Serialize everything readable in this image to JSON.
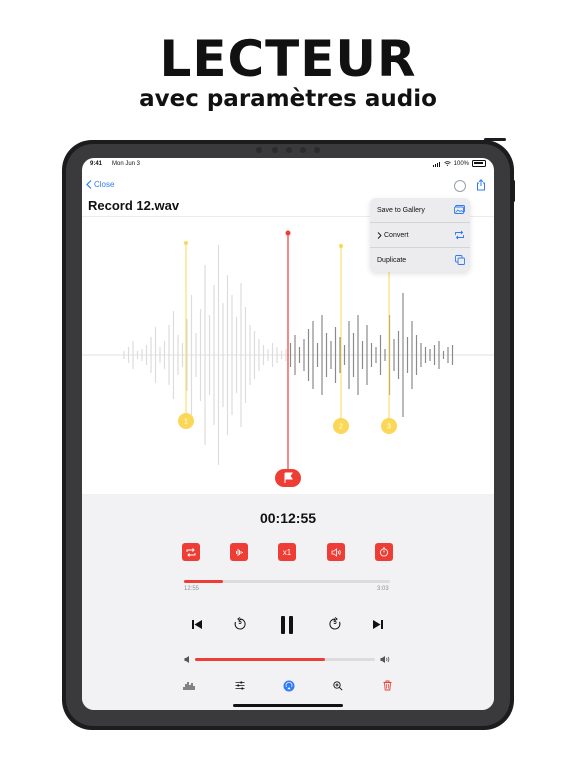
{
  "hero": {
    "title": "LECTEUR",
    "subtitle": "avec paramètres audio"
  },
  "status_bar": {
    "time": "9:41",
    "date": "Mon Jun 3",
    "battery": "100%"
  },
  "nav": {
    "close_label": "Close",
    "title": "Record 12.wav"
  },
  "menu": {
    "items": [
      {
        "label": "Save to Gallery",
        "icon": "gallery-icon"
      },
      {
        "label": "Convert",
        "icon": "convert-icon"
      },
      {
        "label": "Duplicate",
        "icon": "duplicate-icon"
      }
    ]
  },
  "markers": [
    {
      "label": "1",
      "color": "#fbd757"
    },
    {
      "label": "2",
      "color": "#fbd757"
    },
    {
      "label": "3",
      "color": "#fbd757"
    }
  ],
  "playhead": {
    "color": "#ee3d35",
    "flag_icon": "flag-icon"
  },
  "player": {
    "current_time": "00:12:55",
    "elapsed": "12:55",
    "remaining": "3:03",
    "progress": 0.19,
    "volume": 0.72,
    "speed_label": "x1",
    "accent_color": "#ee3d35"
  },
  "action_buttons": [
    "repeat-icon",
    "waveform-icon",
    "speed-label",
    "speaker-icon",
    "timer-icon"
  ],
  "transport": [
    "skip-back-icon",
    "rewind-5-icon",
    "pause-icon",
    "forward-5-icon",
    "skip-forward-icon"
  ],
  "rewind_seconds": "5",
  "forward_seconds": "5",
  "tabbar": [
    "waveform-tab-icon",
    "equalizer-icon",
    "airplay-icon",
    "zoom-icon",
    "trash-icon"
  ]
}
